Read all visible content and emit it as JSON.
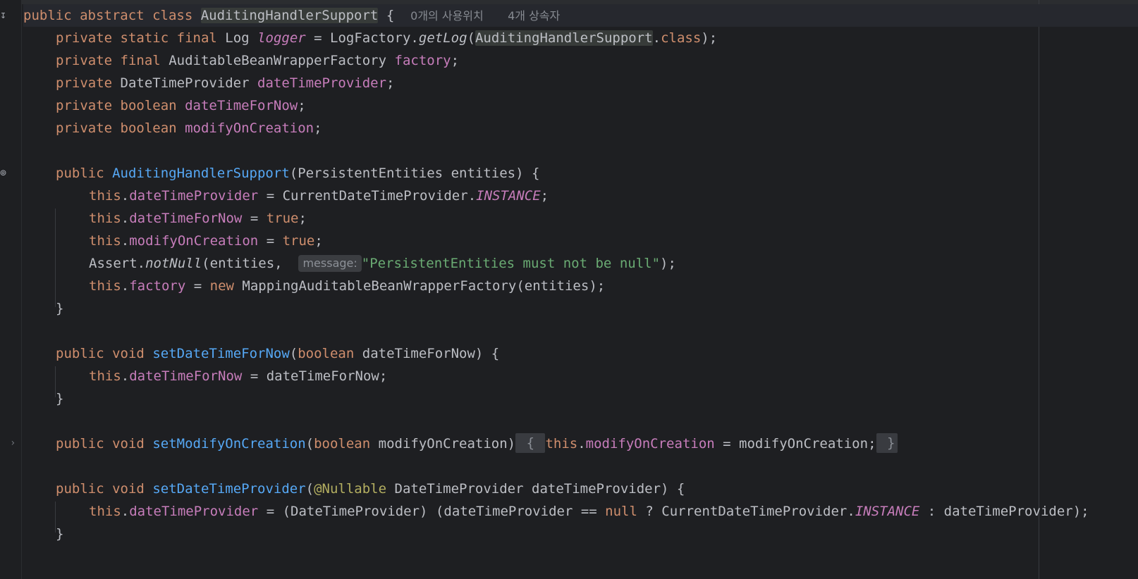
{
  "editor": {
    "usages_hint": "0개의 사용위치",
    "inheritors_hint": "4개 상속자",
    "param_hint_label": "message:",
    "tokens": {
      "public": "public",
      "abstract": "abstract",
      "class": "class",
      "private": "private",
      "static": "static",
      "final": "final",
      "boolean": "boolean",
      "void": "void",
      "this": "this",
      "new": "new",
      "true": "true",
      "null": "null",
      "class_name": "AuditingHandlerSupport",
      "log_type": "Log",
      "logger": "logger",
      "log_factory": "LogFactory",
      "get_log": "getLog",
      "dot_class": "class",
      "abwf_type": "AuditableBeanWrapperFactory",
      "factory": "factory",
      "dtp_type": "DateTimeProvider",
      "date_time_provider": "dateTimeProvider",
      "date_time_for_now": "dateTimeForNow",
      "modify_on_creation": "modifyOnCreation",
      "persistent_entities_type": "PersistentEntities",
      "entities": "entities",
      "current_dtp": "CurrentDateTimeProvider",
      "instance": "INSTANCE",
      "assert": "Assert",
      "not_null": "notNull",
      "error_message": "\"PersistentEntities must not be null\"",
      "mapping_factory": "MappingAuditableBeanWrapperFactory",
      "set_date_time_for_now": "setDateTimeForNow",
      "set_modify_on_creation": "setModifyOnCreation",
      "set_date_time_provider": "setDateTimeProvider",
      "nullable": "@Nullable"
    }
  }
}
